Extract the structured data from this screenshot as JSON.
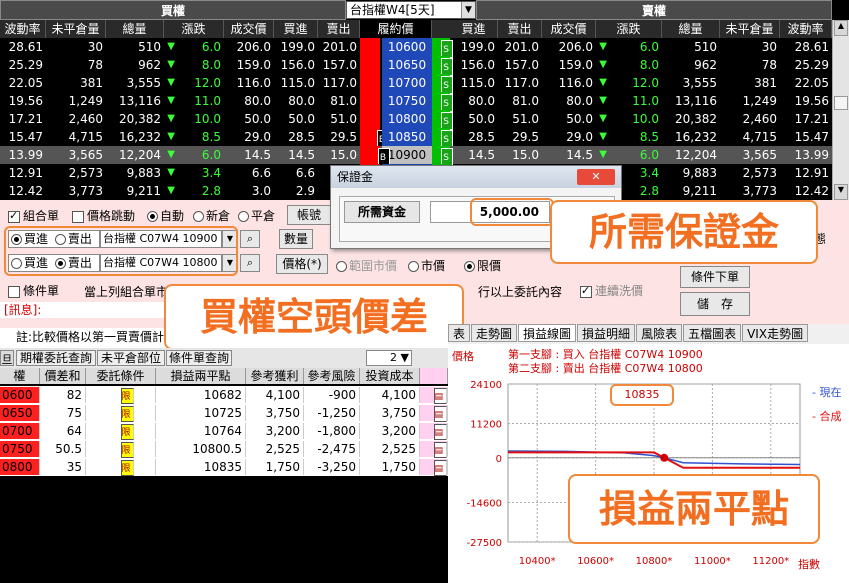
{
  "chain": {
    "call_label": "買權",
    "put_label": "賣權",
    "contract_select": "台指權W4[5天]",
    "headers_left": [
      "波動率",
      "未平倉量",
      "總量",
      "漲跌",
      "成交價",
      "買進",
      "賣出"
    ],
    "strike_header": "履約價",
    "headers_right": [
      "買進",
      "賣出",
      "成交價",
      "漲跌",
      "總量",
      "未平倉量",
      "波動率"
    ],
    "rows": [
      {
        "l": [
          "28.61",
          "30",
          "510",
          "▼",
          "6.0",
          "206.0",
          "199.0",
          "201.0"
        ],
        "strike": "10600",
        "r": [
          "199.0",
          "201.0",
          "206.0",
          "▼",
          "6.0",
          "510",
          "30",
          "28.61"
        ]
      },
      {
        "l": [
          "25.29",
          "78",
          "962",
          "▼",
          "8.0",
          "159.0",
          "156.0",
          "157.0"
        ],
        "strike": "10650",
        "r": [
          "156.0",
          "157.0",
          "159.0",
          "▼",
          "8.0",
          "962",
          "78",
          "25.29"
        ]
      },
      {
        "l": [
          "22.05",
          "381",
          "3,555",
          "▼",
          "12.0",
          "116.0",
          "115.0",
          "117.0"
        ],
        "strike": "10700",
        "r": [
          "115.0",
          "117.0",
          "116.0",
          "▼",
          "12.0",
          "3,555",
          "381",
          "22.05"
        ]
      },
      {
        "l": [
          "19.56",
          "1,249",
          "13,116",
          "▼",
          "11.0",
          "80.0",
          "80.0",
          "81.0"
        ],
        "strike": "10750",
        "r": [
          "80.0",
          "81.0",
          "80.0",
          "▼",
          "11.0",
          "13,116",
          "1,249",
          "19.56"
        ]
      },
      {
        "l": [
          "17.21",
          "2,460",
          "20,382",
          "▼",
          "10.0",
          "50.0",
          "50.0",
          "51.0"
        ],
        "strike": "10800",
        "r": [
          "50.0",
          "51.0",
          "50.0",
          "▼",
          "10.0",
          "20,382",
          "2,460",
          "17.21"
        ]
      },
      {
        "l": [
          "15.47",
          "4,715",
          "16,232",
          "▼",
          "8.5",
          "29.0",
          "28.5",
          "29.5"
        ],
        "strike": "10850",
        "r": [
          "28.5",
          "29.5",
          "29.0",
          "▼",
          "8.5",
          "16,232",
          "4,715",
          "15.47"
        ]
      },
      {
        "l": [
          "13.99",
          "3,565",
          "12,204",
          "▼",
          "6.0",
          "14.5",
          "14.5",
          "15.0"
        ],
        "strike": "10900",
        "r": [
          "14.5",
          "15.0",
          "14.5",
          "▼",
          "6.0",
          "12,204",
          "3,565",
          "13.99"
        ]
      },
      {
        "l": [
          "12.91",
          "2,573",
          "9,883",
          "▼",
          "3.4",
          "6.6",
          "6.6",
          ""
        ],
        "strike": "",
        "r": [
          "",
          "",
          "",
          "▼",
          "3.4",
          "9,883",
          "2,573",
          "12.91"
        ]
      },
      {
        "l": [
          "12.42",
          "3,773",
          "9,211",
          "▼",
          "2.8",
          "3.0",
          "2.9",
          ""
        ],
        "strike": "",
        "r": [
          "",
          "",
          "",
          "▼",
          "2.8",
          "9,211",
          "3,773",
          "12.42"
        ]
      }
    ],
    "s_icon": "S",
    "b_icon": "B"
  },
  "order": {
    "combo": "組合單",
    "price_jump": "價格跳動",
    "auto": "自動",
    "new": "新倉",
    "close": "平倉",
    "account_btn": "帳號",
    "leg1_buy": "買進",
    "leg1_sell": "賣出",
    "leg1_contract": "台指權 C07W4 10900",
    "leg2_buy": "買進",
    "leg2_sell": "賣出",
    "leg2_contract": "台指權 C07W4 10800",
    "qty_btn": "數量",
    "price_btn": "價格(*)",
    "range_mkt": "範圍市價",
    "market": "市價",
    "limit": "限價",
    "cond_order": "條件單",
    "notice": "當上列組合單市",
    "notice2": "行以上委託內容",
    "continuous": "連續洗價",
    "cond_btn": "條件下單",
    "save_btn": "儲　存",
    "partial": "態",
    "msg": "[訊息]:",
    "note": "註:比較價格以第一買賣價計"
  },
  "margin_dialog": {
    "title": "保證金",
    "label": "所需資金",
    "value": "5,000.00"
  },
  "callouts": {
    "margin": "所需保證金",
    "spread": "買權空頭價差",
    "breakeven": "損益兩平點"
  },
  "lower": {
    "tabs": [
      "期權委託查詢",
      "未平倉部位",
      "條件單查詢"
    ],
    "headers": [
      "權",
      "價差和",
      "委託條件",
      "損益兩平點",
      "參考獲利",
      "參考風險",
      "投資成本"
    ],
    "rows": [
      {
        "idx": "0600",
        "spread": "82",
        "be": "10682",
        "profit": "4,100",
        "risk": "-900",
        "cost": "4,100"
      },
      {
        "idx": "0650",
        "spread": "75",
        "be": "10725",
        "profit": "3,750",
        "risk": "-1,250",
        "cost": "3,750"
      },
      {
        "idx": "0700",
        "spread": "64",
        "be": "10764",
        "profit": "3,200",
        "risk": "-1,800",
        "cost": "3,200"
      },
      {
        "idx": "0750",
        "spread": "50.5",
        "be": "10800.5",
        "profit": "2,525",
        "risk": "-2,475",
        "cost": "2,525"
      },
      {
        "idx": "0800",
        "spread": "35",
        "be": "10835",
        "profit": "1,750",
        "risk": "-3,250",
        "cost": "1,750"
      }
    ],
    "cond_a": "僞",
    "cond_b": "限"
  },
  "right": {
    "tabs": [
      "表",
      "走勢圖",
      "損益線圖",
      "損益明細",
      "風險表",
      "五檔圖表",
      "VIX走勢圖"
    ],
    "ylabel": "價格",
    "leg1": "第一支腳 : 買入 台指權 C07W4 10900",
    "leg2": "第二支腳 : 賣出 台指權 C07W4 10800",
    "legend_now": "- 現在",
    "legend_combo": "- 合成",
    "be_label": "10835",
    "xlabel": "指數",
    "yticks": [
      "24100",
      "11200",
      "0",
      "-14600",
      "-27500"
    ],
    "xticks": [
      "10400*",
      "10600*",
      "10800*",
      "11000*",
      "11200*"
    ]
  },
  "chart_data": {
    "type": "line",
    "title": "",
    "xlabel": "指數",
    "ylabel": "價格",
    "x": [
      10300,
      10500,
      10700,
      10800,
      10835,
      10900,
      11100,
      11300
    ],
    "series": [
      {
        "name": "現在",
        "values": [
          2200,
          2100,
          1600,
          700,
          0,
          -1600,
          -2000,
          -2200
        ]
      },
      {
        "name": "合成",
        "values": [
          1750,
          1750,
          1750,
          1750,
          0,
          -3250,
          -3250,
          -3250
        ]
      }
    ],
    "ylim": [
      -27500,
      24100
    ],
    "colors": {
      "now": "#3050d0",
      "combo": "#e01010"
    }
  }
}
